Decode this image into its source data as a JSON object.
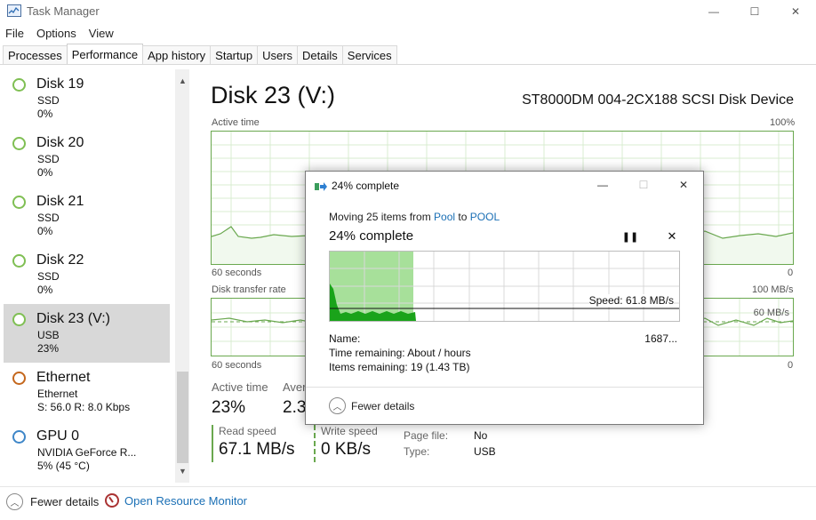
{
  "window": {
    "title": "Task Manager",
    "minimize_glyph": "—",
    "maximize_glyph": "☐",
    "close_glyph": "✕"
  },
  "menu": {
    "items": [
      "File",
      "Options",
      "View"
    ]
  },
  "tabs": [
    "Processes",
    "Performance",
    "App history",
    "Startup",
    "Users",
    "Details",
    "Services"
  ],
  "active_tab": "Performance",
  "sidebar": {
    "items": [
      {
        "name": "Disk 19",
        "line1": "SSD",
        "line2": "0%",
        "status_color": "#7fbf53"
      },
      {
        "name": "Disk 20",
        "line1": "SSD",
        "line2": "0%",
        "status_color": "#7fbf53"
      },
      {
        "name": "Disk 21",
        "line1": "SSD",
        "line2": "0%",
        "status_color": "#7fbf53"
      },
      {
        "name": "Disk 22",
        "line1": "SSD",
        "line2": "0%",
        "status_color": "#7fbf53"
      },
      {
        "name": "Disk 23 (V:)",
        "line1": "USB",
        "line2": "23%",
        "status_color": "#7fbf53",
        "selected": true
      },
      {
        "name": "Ethernet",
        "line1": "Ethernet",
        "line2": "S: 56.0  R: 8.0 Kbps",
        "status_color": "#c4671d"
      },
      {
        "name": "GPU 0",
        "line1": "NVIDIA GeForce R...",
        "line2": "5% (45 °C)",
        "status_color": "#3e86c8"
      }
    ]
  },
  "main": {
    "title": "Disk 23 (V:)",
    "device": "ST8000DM 004-2CX188 SCSI Disk Device",
    "active_time_chart": {
      "label": "Active time",
      "max_label": "100%",
      "x_left": "60 seconds",
      "x_right": "0"
    },
    "transfer_chart": {
      "label": "Disk transfer rate",
      "max_label": "100 MB/s",
      "mid_label": "60 MB/s",
      "x_left": "60 seconds",
      "x_right": "0"
    },
    "stats": {
      "active_time_label": "Active time",
      "active_time_value": "23%",
      "avg_label": "Aver",
      "avg_value": "2.3",
      "read_speed_label": "Read speed",
      "read_speed_value": "67.1 MB/s",
      "write_speed_label": "Write speed",
      "write_speed_value": "0 KB/s",
      "page_file_label": "Page file:",
      "page_file_value": "No",
      "type_label": "Type:",
      "type_value": "USB"
    }
  },
  "footer": {
    "fewer_details": "Fewer details",
    "open_resource_monitor": "Open Resource Monitor"
  },
  "dialog": {
    "title": "24% complete",
    "moving_prefix": "Moving 25 items from ",
    "source": "Pool",
    "moving_mid": " to ",
    "destination": "POOL",
    "progress_text": "24% complete",
    "progress_fraction": 0.24,
    "speed": "Speed: 61.8 MB/s",
    "name_label": "Name:",
    "name_value": "1687...",
    "time_remaining": "Time remaining:  About / hours",
    "items_remaining": "Items remaining:  19 (1.43 TB)",
    "fewer_details": "Fewer details"
  },
  "colors": {
    "graph_green": "#6aa84f",
    "fill_green": "#a7e09a",
    "dark_green": "#1aa31a",
    "link_blue": "#1a6fb5"
  }
}
